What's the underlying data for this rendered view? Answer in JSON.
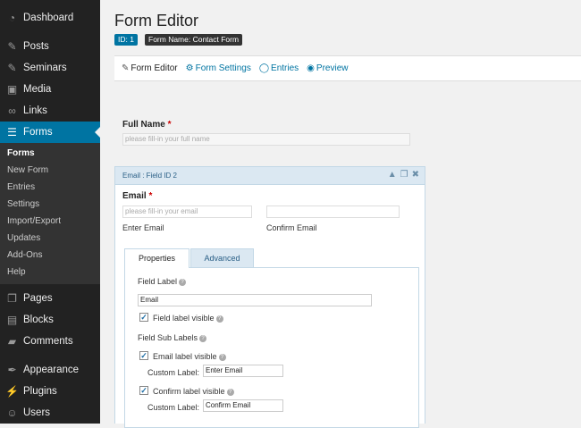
{
  "sidebar": {
    "items_top": [
      {
        "label": "Dashboard",
        "icon": "dashboard-icon"
      },
      {
        "label": "Posts",
        "icon": "pin-icon"
      },
      {
        "label": "Seminars",
        "icon": "pin-icon"
      },
      {
        "label": "Media",
        "icon": "media-icon"
      },
      {
        "label": "Links",
        "icon": "link-icon"
      },
      {
        "label": "Forms",
        "icon": "forms-icon"
      }
    ],
    "submenu": [
      "Forms",
      "New Form",
      "Entries",
      "Settings",
      "Import/Export",
      "Updates",
      "Add-Ons",
      "Help"
    ],
    "items_bottom": [
      {
        "label": "Pages",
        "icon": "pages-icon"
      },
      {
        "label": "Blocks",
        "icon": "blocks-icon"
      },
      {
        "label": "Comments",
        "icon": "comments-icon"
      },
      {
        "label": "Appearance",
        "icon": "appearance-icon"
      },
      {
        "label": "Plugins",
        "icon": "plugins-icon"
      },
      {
        "label": "Users",
        "icon": "users-icon"
      }
    ]
  },
  "header": {
    "title": "Form Editor",
    "id_badge": "ID: 1",
    "name_badge": "Form Name: Contact Form"
  },
  "toolbar": {
    "form_editor": "Form Editor",
    "form_settings": "Form Settings",
    "entries": "Entries",
    "preview": "Preview"
  },
  "full_name": {
    "label": "Full Name",
    "required_mark": "*",
    "placeholder": "please fill-in your full name"
  },
  "email_field": {
    "header": "Email : Field ID 2",
    "label": "Email",
    "required_mark": "*",
    "placeholder": "please fill-in your email",
    "enter_label": "Enter Email",
    "confirm_label": "Confirm Email",
    "tabs": {
      "properties": "Properties",
      "advanced": "Advanced"
    },
    "properties": {
      "field_label_title": "Field Label",
      "field_label_value": "Email",
      "field_label_visible": "Field label visible",
      "sub_labels_title": "Field Sub Labels",
      "email_label_visible": "Email label visible",
      "custom_label_1": "Custom Label:",
      "custom_value_1": "Enter Email",
      "confirm_label_visible": "Confirm label visible",
      "custom_label_2": "Custom Label:",
      "custom_value_2": "Confirm Email"
    }
  },
  "colors": {
    "accent": "#0074a2",
    "sidebar": "#222222",
    "panel_head": "#dbe8f2"
  }
}
